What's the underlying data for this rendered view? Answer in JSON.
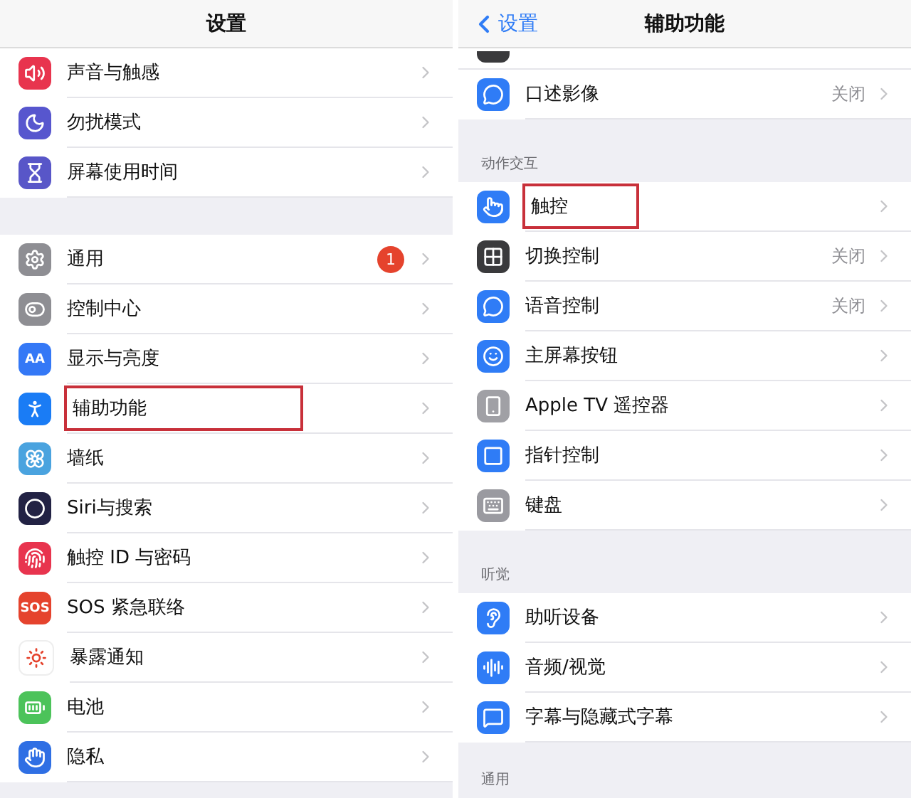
{
  "left": {
    "title": "设置",
    "groups": [
      {
        "items": [
          {
            "label": "声音与触感",
            "color": "#e8344e",
            "highlighted": false
          },
          {
            "label": "勿扰模式",
            "color": "#5756ce",
            "highlighted": false
          },
          {
            "label": "屏幕使用时间",
            "color": "#5856c8",
            "highlighted": false
          }
        ]
      },
      {
        "items": [
          {
            "label": "通用",
            "color": "#8e8e93",
            "badge": "1",
            "highlighted": false
          },
          {
            "label": "控制中心",
            "color": "#8e8e93",
            "highlighted": false
          },
          {
            "label": "显示与亮度",
            "color": "#3478f6",
            "icon_text": "AA",
            "highlighted": false
          },
          {
            "label": "辅助功能",
            "color": "#1a7cf5",
            "highlighted": true
          },
          {
            "label": "墙纸",
            "color": "#4aa3df",
            "highlighted": false
          },
          {
            "label": "Siri与搜索",
            "color": "#222244",
            "highlighted": false
          },
          {
            "label": "触控 ID 与密码",
            "color": "#e8344e",
            "highlighted": false
          },
          {
            "label": "SOS 紧急联络",
            "color": "#e5432d",
            "icon_text": "SOS",
            "highlighted": false
          },
          {
            "label": "暴露通知",
            "color": "#ffffff",
            "highlighted": false
          },
          {
            "label": "电池",
            "color": "#4cc35a",
            "highlighted": false
          },
          {
            "label": "隐私",
            "color": "#2f6fe4",
            "highlighted": false
          }
        ]
      }
    ]
  },
  "right": {
    "back": "设置",
    "title": "辅助功能",
    "groups": [
      {
        "items": [
          {
            "label": "口述影像",
            "color": "#2f7cf6",
            "value": "关闭",
            "highlighted": false
          }
        ]
      },
      {
        "header": "动作交互",
        "items": [
          {
            "label": "触控",
            "color": "#2f7cf6",
            "highlighted": true
          },
          {
            "label": "切换控制",
            "color": "#3a3a3c",
            "value": "关闭",
            "highlighted": false
          },
          {
            "label": "语音控制",
            "color": "#2f7cf6",
            "value": "关闭",
            "highlighted": false
          },
          {
            "label": "主屏幕按钮",
            "color": "#2f7cf6",
            "highlighted": false
          },
          {
            "label": "Apple TV 遥控器",
            "color": "#a0a0a5",
            "highlighted": false
          },
          {
            "label": "指针控制",
            "color": "#2f7cf6",
            "highlighted": false
          },
          {
            "label": "键盘",
            "color": "#9a9aa0",
            "highlighted": false
          }
        ]
      },
      {
        "header": "听觉",
        "items": [
          {
            "label": "助听设备",
            "color": "#2f7cf6",
            "highlighted": false
          },
          {
            "label": "音频/视觉",
            "color": "#2f7cf6",
            "highlighted": false
          },
          {
            "label": "字幕与隐藏式字幕",
            "color": "#2f7cf6",
            "highlighted": false
          }
        ]
      },
      {
        "header": "通用"
      }
    ]
  }
}
